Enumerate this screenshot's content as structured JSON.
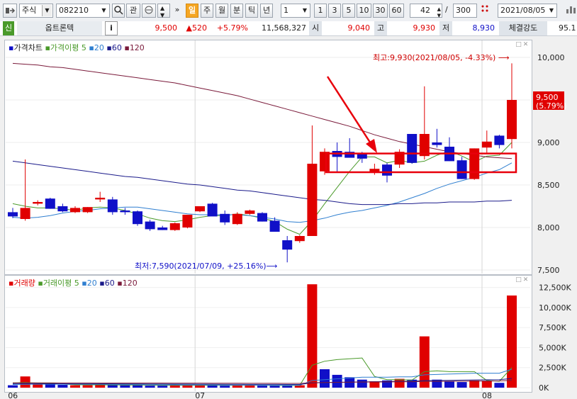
{
  "toolbar": {
    "market": "주식",
    "code": "082210",
    "btn_gwan": "관",
    "periods": [
      "일",
      "주",
      "월",
      "분",
      "틱",
      "년"
    ],
    "interval_value": "1",
    "presets": [
      "1",
      "3",
      "5",
      "10",
      "30",
      "60"
    ],
    "count_value": "42",
    "count_sep": "/",
    "count_total": "300",
    "date": "2021/08/05"
  },
  "info": {
    "flag": "신",
    "name": "옵트론텍",
    "i_label": "i",
    "price": "9,500",
    "change": "▲520",
    "change_pct": "+5.79%",
    "volume": "11,568,327",
    "open_label": "시",
    "open": "9,040",
    "high_label": "고",
    "high": "9,930",
    "low_label": "저",
    "low": "8,930",
    "strength_label": "체결강도",
    "strength": "95.1"
  },
  "price_panel": {
    "legend": {
      "main": "가격차트",
      "ma_label": "가격이평",
      "ma_periods": [
        "5",
        "20",
        "60",
        "120"
      ]
    },
    "yticks": [
      "10,000",
      "9,500",
      "9,000",
      "8,500",
      "8,000",
      "7,500"
    ],
    "max_annotation": "최고:9,930(2021/08/05, -4.33%)",
    "min_annotation": "최저:7,590(2021/07/09, +25.16%)",
    "current_price": "9,500",
    "current_pct": "(5.79%)"
  },
  "volume_panel": {
    "legend": {
      "main": "거래량",
      "ma_label": "거래이평",
      "ma_periods": [
        "5",
        "20",
        "60",
        "120"
      ]
    },
    "yticks": [
      "12,500K",
      "10,000K",
      "7,500K",
      "5,000K",
      "2,500K",
      "0K"
    ]
  },
  "xaxis": {
    "labels": [
      "06",
      "07",
      "08"
    ]
  },
  "colors": {
    "up": "#e00000",
    "down": "#1010c8",
    "ma5": "#4a9a2a",
    "ma20": "#2f7fd0",
    "ma60": "#1a1a8a",
    "ma120": "#7a1a3a",
    "annotation_box": "#e8000b"
  },
  "chart_data": [
    {
      "type": "candlestick",
      "title": "가격차트",
      "ylim": [
        7500,
        10000
      ],
      "x": [
        "06",
        "",
        "",
        "",
        "",
        "",
        "",
        "",
        "",
        "",
        "",
        "",
        "",
        "",
        "",
        "07",
        "",
        "",
        "",
        "",
        "",
        "",
        "",
        "",
        "",
        "",
        "",
        "",
        "",
        "",
        "",
        "",
        "",
        "",
        "",
        "",
        "",
        "",
        "08",
        "",
        "",
        ""
      ],
      "candles": [
        {
          "o": 8180,
          "h": 8230,
          "l": 8110,
          "c": 8130
        },
        {
          "o": 8100,
          "h": 8800,
          "l": 8080,
          "c": 8230
        },
        {
          "o": 8280,
          "h": 8320,
          "l": 8260,
          "c": 8300
        },
        {
          "o": 8340,
          "h": 8350,
          "l": 8220,
          "c": 8220
        },
        {
          "o": 8250,
          "h": 8280,
          "l": 8180,
          "c": 8190
        },
        {
          "o": 8180,
          "h": 8250,
          "l": 8170,
          "c": 8230
        },
        {
          "o": 8180,
          "h": 8240,
          "l": 8170,
          "c": 8240
        },
        {
          "o": 8330,
          "h": 8420,
          "l": 8300,
          "c": 8350
        },
        {
          "o": 8330,
          "h": 8360,
          "l": 8150,
          "c": 8180
        },
        {
          "o": 8200,
          "h": 8230,
          "l": 8150,
          "c": 8180
        },
        {
          "o": 8190,
          "h": 8200,
          "l": 8020,
          "c": 8040
        },
        {
          "o": 8070,
          "h": 8090,
          "l": 7960,
          "c": 7980
        },
        {
          "o": 8000,
          "h": 8020,
          "l": 7970,
          "c": 7970
        },
        {
          "o": 7970,
          "h": 8060,
          "l": 7960,
          "c": 8050
        },
        {
          "o": 8000,
          "h": 8150,
          "l": 7990,
          "c": 8150
        },
        {
          "o": 8190,
          "h": 8250,
          "l": 8180,
          "c": 8250
        },
        {
          "o": 8280,
          "h": 8290,
          "l": 8140,
          "c": 8130
        },
        {
          "o": 8160,
          "h": 8200,
          "l": 8030,
          "c": 8060
        },
        {
          "o": 8040,
          "h": 8180,
          "l": 8030,
          "c": 8160
        },
        {
          "o": 8160,
          "h": 8210,
          "l": 8150,
          "c": 8200
        },
        {
          "o": 8170,
          "h": 8180,
          "l": 8070,
          "c": 8070
        },
        {
          "o": 8080,
          "h": 8120,
          "l": 7950,
          "c": 7950
        },
        {
          "o": 7850,
          "h": 7900,
          "l": 7590,
          "c": 7740
        },
        {
          "o": 7840,
          "h": 7910,
          "l": 7820,
          "c": 7900
        },
        {
          "o": 7900,
          "h": 9200,
          "l": 7900,
          "c": 8750
        },
        {
          "o": 8660,
          "h": 8930,
          "l": 8620,
          "c": 8890
        },
        {
          "o": 8900,
          "h": 9000,
          "l": 8650,
          "c": 8830
        },
        {
          "o": 8890,
          "h": 9050,
          "l": 8830,
          "c": 8820
        },
        {
          "o": 8870,
          "h": 8890,
          "l": 8760,
          "c": 8810
        },
        {
          "o": 8650,
          "h": 8750,
          "l": 8620,
          "c": 8690
        },
        {
          "o": 8740,
          "h": 8760,
          "l": 8530,
          "c": 8610
        },
        {
          "o": 8740,
          "h": 8920,
          "l": 8700,
          "c": 8890
        },
        {
          "o": 9100,
          "h": 9100,
          "l": 8750,
          "c": 8760
        },
        {
          "o": 8840,
          "h": 9660,
          "l": 8800,
          "c": 9100
        },
        {
          "o": 9000,
          "h": 9160,
          "l": 8940,
          "c": 8970
        },
        {
          "o": 8950,
          "h": 9060,
          "l": 8780,
          "c": 8780
        },
        {
          "o": 8790,
          "h": 8830,
          "l": 8570,
          "c": 8570
        },
        {
          "o": 8570,
          "h": 8930,
          "l": 8560,
          "c": 8930
        },
        {
          "o": 8940,
          "h": 9140,
          "l": 8880,
          "c": 9010
        },
        {
          "o": 9080,
          "h": 9090,
          "l": 8930,
          "c": 8970
        },
        {
          "o": 9040,
          "h": 9930,
          "l": 8930,
          "c": 9500
        }
      ],
      "series": [
        {
          "name": "5",
          "values": [
            8280,
            8250,
            8230,
            8230,
            8220,
            8200,
            8230,
            8240,
            8230,
            8200,
            8160,
            8110,
            8080,
            8070,
            8090,
            8120,
            8140,
            8140,
            8160,
            8140,
            8110,
            8070,
            7980,
            7920,
            8080,
            8280,
            8470,
            8660,
            8830,
            8830,
            8760,
            8790,
            8760,
            8780,
            8850,
            8900,
            8840,
            8770,
            8840,
            8850,
            9000
          ]
        },
        {
          "name": "20",
          "values": [
            8120,
            8110,
            8120,
            8140,
            8170,
            8190,
            8200,
            8220,
            8230,
            8240,
            8240,
            8220,
            8200,
            8180,
            8160,
            8150,
            8150,
            8150,
            8150,
            8140,
            8120,
            8100,
            8070,
            8060,
            8080,
            8110,
            8150,
            8180,
            8200,
            8230,
            8260,
            8300,
            8350,
            8400,
            8460,
            8510,
            8550,
            8590,
            8640,
            8680,
            8760
          ]
        },
        {
          "name": "60",
          "values": [
            8780,
            8760,
            8740,
            8720,
            8700,
            8680,
            8660,
            8640,
            8620,
            8600,
            8590,
            8570,
            8550,
            8530,
            8510,
            8500,
            8480,
            8460,
            8440,
            8430,
            8410,
            8390,
            8370,
            8350,
            8330,
            8320,
            8300,
            8280,
            8270,
            8270,
            8270,
            8280,
            8280,
            8290,
            8290,
            8300,
            8300,
            8300,
            8310,
            8310,
            8320
          ]
        },
        {
          "name": "120",
          "values": [
            9930,
            9920,
            9910,
            9890,
            9880,
            9860,
            9840,
            9820,
            9800,
            9780,
            9760,
            9740,
            9720,
            9700,
            9670,
            9640,
            9610,
            9580,
            9550,
            9510,
            9470,
            9430,
            9390,
            9350,
            9310,
            9270,
            9230,
            9190,
            9140,
            9090,
            9050,
            9010,
            8980,
            8950,
            8920,
            8890,
            8870,
            8850,
            8830,
            8820,
            8810
          ]
        }
      ]
    },
    {
      "type": "bar",
      "title": "거래량",
      "ylim": [
        0,
        13000
      ],
      "unit": "K",
      "values": [
        300,
        1400,
        400,
        400,
        350,
        300,
        300,
        400,
        350,
        300,
        300,
        250,
        250,
        300,
        300,
        350,
        300,
        250,
        300,
        350,
        250,
        250,
        300,
        300,
        12900,
        2300,
        1600,
        1300,
        1000,
        800,
        900,
        1100,
        1000,
        6400,
        1000,
        800,
        700,
        900,
        800,
        600,
        11500
      ],
      "up": [
        false,
        true,
        true,
        false,
        false,
        true,
        true,
        true,
        false,
        false,
        false,
        false,
        false,
        true,
        true,
        true,
        false,
        false,
        true,
        true,
        false,
        false,
        false,
        true,
        true,
        false,
        false,
        false,
        false,
        true,
        false,
        true,
        false,
        true,
        false,
        false,
        false,
        true,
        true,
        false,
        true
      ],
      "series": [
        {
          "name": "5",
          "values": [
            600,
            650,
            580,
            560,
            450,
            370,
            350,
            350,
            340,
            330,
            330,
            320,
            300,
            300,
            300,
            300,
            300,
            300,
            300,
            310,
            300,
            280,
            270,
            280,
            2800,
            3300,
            3500,
            3600,
            3700,
            1400,
            1000,
            1000,
            950,
            2000,
            2100,
            2000,
            2000,
            2000,
            900,
            800,
            2500
          ]
        },
        {
          "name": "20",
          "values": [
            400,
            420,
            430,
            430,
            430,
            430,
            420,
            420,
            410,
            400,
            400,
            380,
            360,
            350,
            340,
            340,
            340,
            330,
            320,
            320,
            310,
            300,
            300,
            300,
            900,
            1000,
            1100,
            1200,
            1300,
            1300,
            1300,
            1350,
            1350,
            1600,
            1650,
            1700,
            1750,
            1800,
            1800,
            1800,
            2300
          ]
        },
        {
          "name": "60",
          "values": [
            500,
            500,
            500,
            490,
            490,
            480,
            480,
            470,
            470,
            460,
            460,
            450,
            450,
            440,
            440,
            430,
            430,
            420,
            420,
            410,
            410,
            410,
            400,
            400,
            600,
            630,
            660,
            690,
            720,
            740,
            760,
            780,
            800,
            880,
            900,
            920,
            940,
            960,
            980,
            1000,
            1150
          ]
        },
        {
          "name": "120",
          "values": [
            600,
            600,
            600,
            600,
            590,
            590,
            590,
            580,
            580,
            580,
            570,
            570,
            570,
            560,
            560,
            560,
            550,
            550,
            550,
            540,
            540,
            540,
            530,
            530,
            620,
            640,
            660,
            680,
            700,
            710,
            720,
            730,
            740,
            780,
            790,
            800,
            810,
            820,
            830,
            840,
            920
          ]
        }
      ]
    }
  ]
}
